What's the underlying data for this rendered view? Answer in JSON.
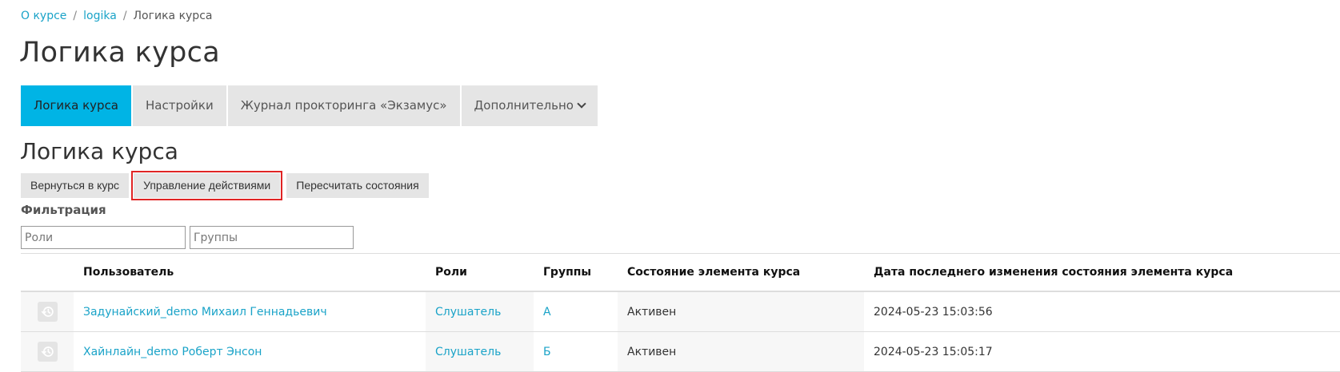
{
  "breadcrumb": [
    "О курсе",
    "logika",
    "Логика курса"
  ],
  "page_title": "Логика курса",
  "tabs": [
    {
      "label": "Логика курса",
      "active": true
    },
    {
      "label": "Настройки",
      "active": false
    },
    {
      "label": "Журнал прокторинга «Экзамус»",
      "active": false
    },
    {
      "label": "Дополнительно",
      "active": false
    }
  ],
  "section_title": "Логика курса",
  "buttons": [
    {
      "label": "Вернуться в курс"
    },
    {
      "label": "Управление действиями"
    },
    {
      "label": "Пересчитать состояния"
    }
  ],
  "filter": {
    "label": "Фильтрация",
    "roles_placeholder": "Роли",
    "groups_placeholder": "Группы"
  },
  "table": {
    "headers": [
      "Пользователь",
      "Роли",
      "Группы",
      "Состояние элемента курса",
      "Дата последнего изменения состояния элемента курса"
    ],
    "rows": [
      {
        "icon": "history-icon",
        "user": "Задунайский_demo Михаил Геннадьевич",
        "role": "Слушатель",
        "group": "А",
        "state": "Активен",
        "date": "2024-05-23 15:03:56"
      },
      {
        "icon": "history-icon",
        "user": "Хайнлайн_demo Роберт Энсон",
        "role": "Слушатель",
        "group": "Б",
        "state": "Активен",
        "date": "2024-05-23 15:05:17"
      }
    ]
  },
  "colors": {
    "accent": "#00b4e5",
    "link": "#1aa3c8",
    "highlight": "#e02424",
    "tab_bg": "#e5e5e5"
  }
}
